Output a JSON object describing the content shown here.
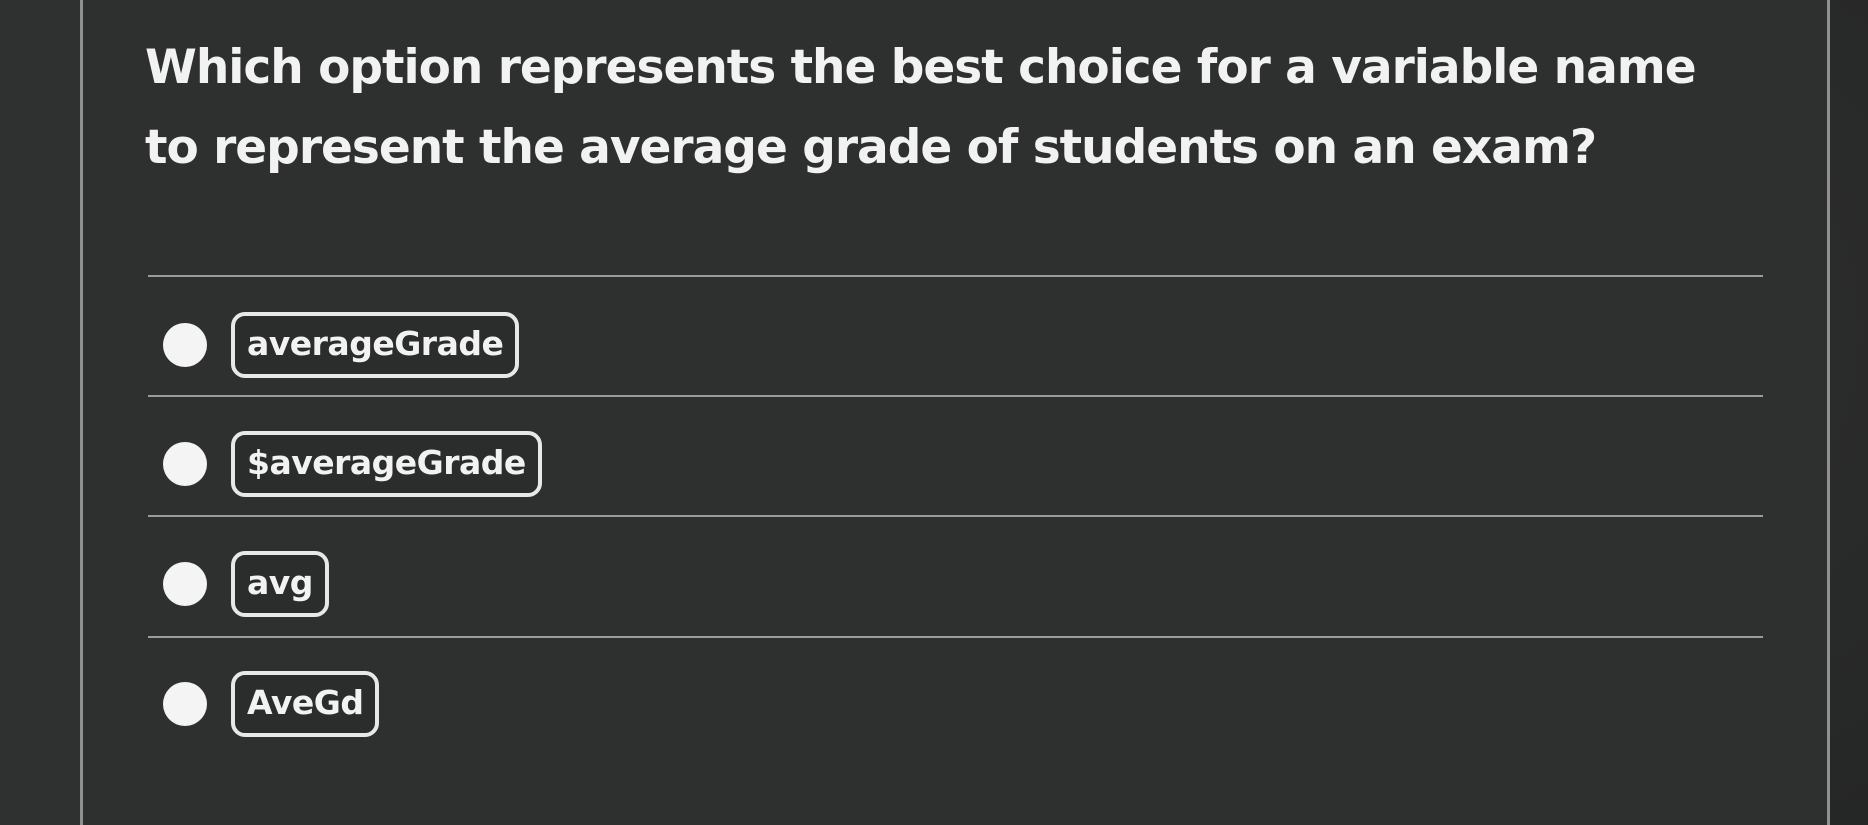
{
  "question": {
    "text": "Which option represents the best choice for a variable name to represent the average grade of students on an exam?"
  },
  "options": [
    {
      "label": "averageGrade"
    },
    {
      "label": "$averageGrade"
    },
    {
      "label": "avg"
    },
    {
      "label": "AveGd"
    }
  ],
  "colors": {
    "background": "#2e2f2f",
    "text": "#f2f2f2",
    "divider": "#9a9b9b",
    "radio": "#f4f4f4"
  }
}
